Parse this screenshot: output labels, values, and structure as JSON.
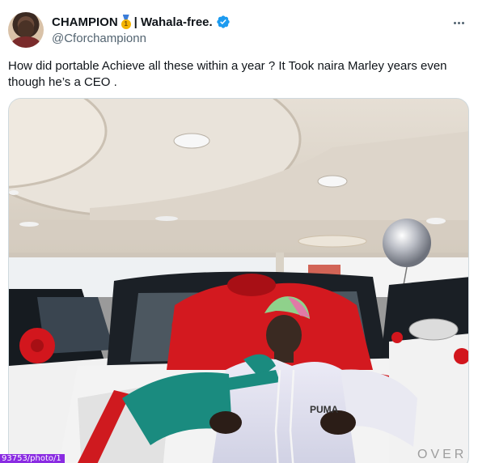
{
  "tweet": {
    "display_name": "CHAMPION",
    "display_name_rest": "| Wahala-free.",
    "medal_icon": "first-place-medal-icon",
    "verified_icon": "verified-badge-icon",
    "handle": "@Cforchampionn",
    "text": "How did portable Achieve all these within a year ? It Took naira Marley years even though he’s a CEO .",
    "more_icon": "more-options-icon"
  },
  "media": {
    "car_badge": "OVER",
    "alt": "photo"
  },
  "status_bar": {
    "url_fragment": "93753/photo/1"
  },
  "colors": {
    "verified": "#1d9bf0",
    "text": "#0f1419",
    "secondary": "#536471",
    "border": "#cfd9de"
  }
}
